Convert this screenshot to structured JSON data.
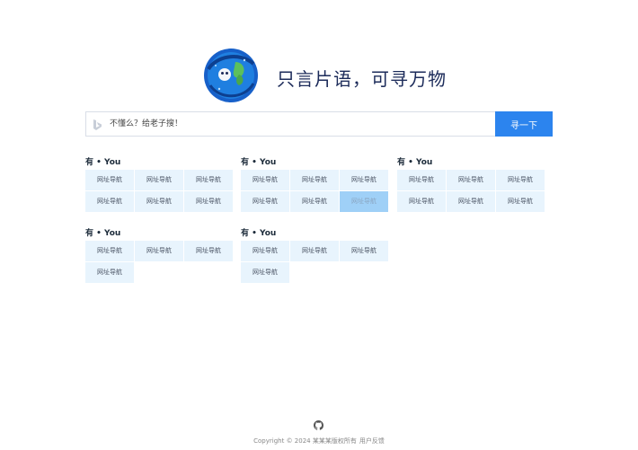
{
  "header": {
    "slogan": "只言片语，可寻万物"
  },
  "search": {
    "placeholder": "不懂么？给老子搜！",
    "button_label": "寻一下",
    "engine_icon": "bing-icon"
  },
  "groups": [
    {
      "title": "有 • You",
      "items": [
        "网址导航",
        "网址导航",
        "网址导航",
        "网址导航",
        "网址导航",
        "网址导航"
      ]
    },
    {
      "title": "有 • You",
      "items": [
        "网址导航",
        "网址导航",
        "网址导航",
        "网址导航",
        "网址导航",
        "网址导航"
      ],
      "active_index": 5
    },
    {
      "title": "有 • You",
      "items": [
        "网址导航",
        "网址导航",
        "网址导航",
        "网址导航",
        "网址导航",
        "网址导航"
      ]
    },
    {
      "title": "有 • You",
      "items": [
        "网址导航",
        "网址导航",
        "网址导航",
        "网址导航"
      ]
    },
    {
      "title": "有 • You",
      "items": [
        "网址导航",
        "网址导航",
        "网址导航",
        "网址导航"
      ]
    }
  ],
  "footer": {
    "copyright": "Copyright © 2024 某某某版权所有",
    "feedback_label": "用户反馈",
    "icon": "github-icon"
  },
  "colors": {
    "accent": "#2c84ee",
    "tile_bg": "#e8f4fd",
    "tile_active": "#9fd0f7",
    "slogan": "#1c2b5a"
  }
}
